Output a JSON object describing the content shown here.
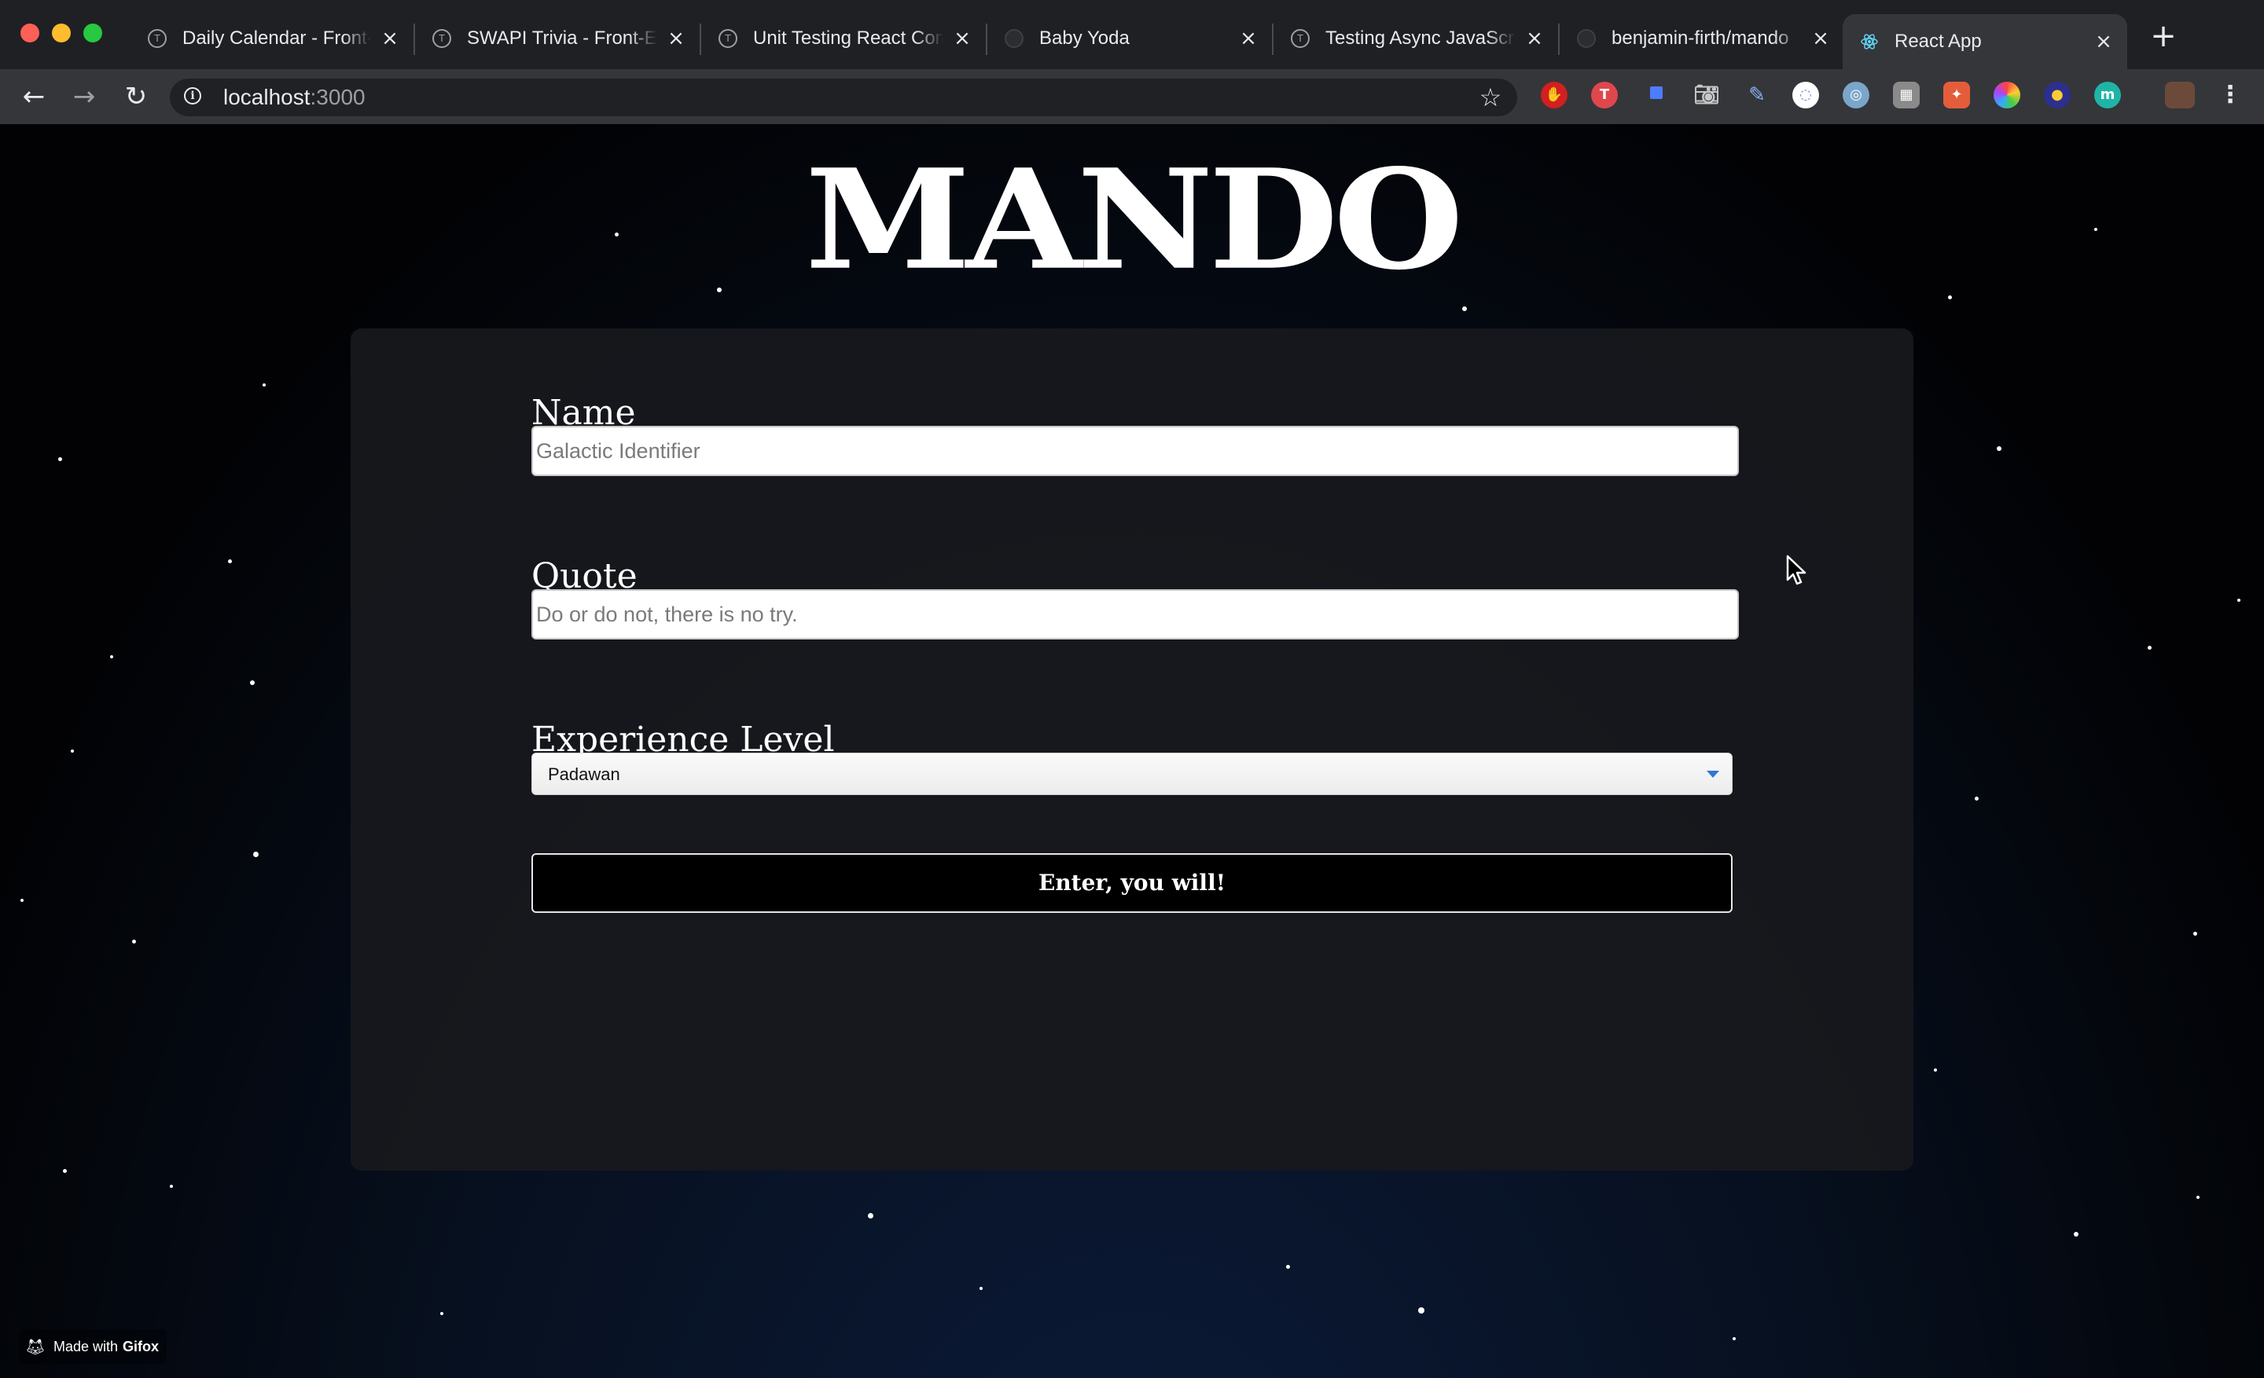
{
  "browser": {
    "tabs": [
      {
        "title": "Daily Calendar - Front-End",
        "icon": "turing-icon",
        "active": false
      },
      {
        "title": "SWAPI Trivia - Front-End",
        "icon": "turing-icon",
        "active": false
      },
      {
        "title": "Unit Testing React Components",
        "icon": "turing-icon",
        "active": false
      },
      {
        "title": "Baby Yoda",
        "icon": "github-icon",
        "active": false
      },
      {
        "title": "Testing Async JavaScript",
        "icon": "turing-icon",
        "active": false
      },
      {
        "title": "benjamin-firth/mando",
        "icon": "github-icon",
        "active": false
      },
      {
        "title": "React App",
        "icon": "react-icon",
        "active": true
      }
    ],
    "address_host": "localhost",
    "address_port": ":3000",
    "colors": {
      "chrome": "#202124",
      "toolbar": "#35363a",
      "active_tab": "#35363a"
    }
  },
  "page": {
    "title": "MANDO",
    "form": {
      "name_label": "Name",
      "name_placeholder": "Galactic Identifier",
      "quote_label": "Quote",
      "quote_placeholder": "Do or do not, there is no try.",
      "experience_label": "Experience Level",
      "experience_selected": "Padawan",
      "submit_label": "Enter, you will!"
    }
  },
  "watermark": {
    "prefix": "Made with",
    "brand": "Gifox"
  }
}
